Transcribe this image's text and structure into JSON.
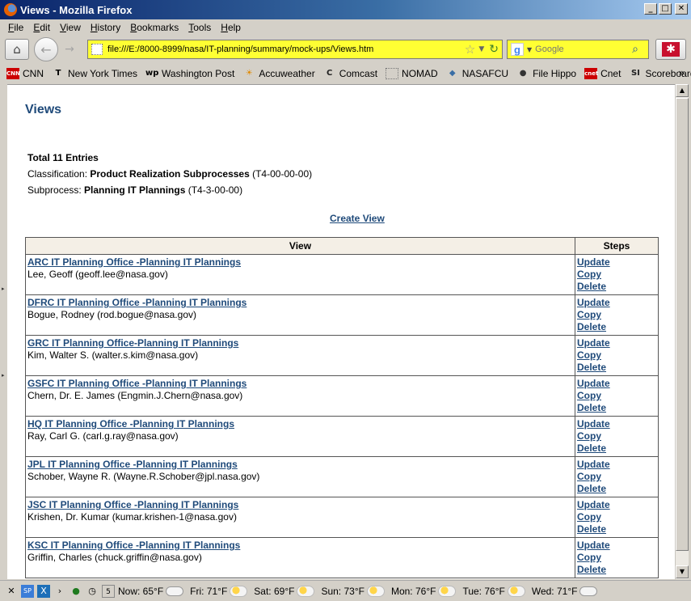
{
  "window": {
    "title": "Views - Mozilla Firefox",
    "buttons": {
      "minimize": "_",
      "maximize": "□",
      "close": "✕"
    }
  },
  "menu": [
    "File",
    "Edit",
    "View",
    "History",
    "Bookmarks",
    "Tools",
    "Help"
  ],
  "navbar": {
    "url": "file:///E:/8000-8999/nasa/IT-planning/summary/mock-ups/Views.htm",
    "search_placeholder": "Google"
  },
  "bookmarks": [
    {
      "label": "CNN",
      "icon": "cnn-icon",
      "glyph": "CNN",
      "color": "#cc0000"
    },
    {
      "label": "New York Times",
      "icon": "nyt-icon",
      "glyph": "T",
      "color": "#000000"
    },
    {
      "label": "Washington Post",
      "icon": "wp-icon",
      "glyph": "wp",
      "color": "#000000"
    },
    {
      "label": "Accuweather",
      "icon": "accuweather-icon",
      "glyph": "☀",
      "color": "#e08a00"
    },
    {
      "label": "Comcast",
      "icon": "comcast-icon",
      "glyph": "C",
      "color": "#222222"
    },
    {
      "label": "NOMAD",
      "icon": "page-icon",
      "glyph": "",
      "color": "#777777"
    },
    {
      "label": "NASAFCU",
      "icon": "nasafcu-icon",
      "glyph": "◆",
      "color": "#3a6ea5"
    },
    {
      "label": "File Hippo",
      "icon": "filehippo-icon",
      "glyph": "●",
      "color": "#333333"
    },
    {
      "label": "Cnet",
      "icon": "cnet-icon",
      "glyph": "cnet",
      "color": "#cc0000"
    },
    {
      "label": "Scoreboards",
      "icon": "si-icon",
      "glyph": "SI",
      "color": "#222222"
    }
  ],
  "page": {
    "title": "Views",
    "total": "Total 11 Entries",
    "classification_label": "Classification:",
    "classification_name": "Product Realization Subprocesses",
    "classification_code": "(T4-00-00-00)",
    "subprocess_label": "Subprocess:",
    "subprocess_name": "Planning IT Plannings",
    "subprocess_code": "(T4-3-00-00)",
    "create_link": "Create View",
    "table": {
      "headers": [
        "View",
        "Steps"
      ],
      "step_links": [
        "Update",
        "Copy",
        "Delete"
      ],
      "rows": [
        {
          "view": "ARC IT Planning Office -Planning IT Plannings",
          "owner": "Lee, Geoff (geoff.lee@nasa.gov)"
        },
        {
          "view": "DFRC IT Planning Office -Planning IT Plannings",
          "owner": "Bogue, Rodney (rod.bogue@nasa.gov)"
        },
        {
          "view": "GRC IT Planning Office-Planning IT Plannings",
          "owner": "Kim, Walter S. (walter.s.kim@nasa.gov)"
        },
        {
          "view": "GSFC IT Planning Office -Planning IT Plannings",
          "owner": "Chern, Dr. E. James (Engmin.J.Chern@nasa.gov)"
        },
        {
          "view": "HQ IT Planning Office -Planning IT Plannings",
          "owner": "Ray, Carl G. (carl.g.ray@nasa.gov)"
        },
        {
          "view": "JPL IT Planning Office -Planning IT Plannings",
          "owner": "Schober, Wayne R. (Wayne.R.Schober@jpl.nasa.gov)"
        },
        {
          "view": "JSC IT Planning Office -Planning IT Plannings",
          "owner": "Krishen, Dr. Kumar (kumar.krishen-1@nasa.gov)"
        },
        {
          "view": "KSC IT Planning Office -Planning IT Plannings",
          "owner": "Griffin, Charles (chuck.griffin@nasa.gov)"
        }
      ]
    }
  },
  "statusbar": {
    "weather": [
      {
        "label": "Now: 65°F",
        "icon": "cloud-icon"
      },
      {
        "label": "Fri: 71°F",
        "icon": "storm-icon"
      },
      {
        "label": "Sat: 69°F",
        "icon": "partly-cloudy-icon"
      },
      {
        "label": "Sun: 73°F",
        "icon": "partly-cloudy-icon"
      },
      {
        "label": "Mon: 76°F",
        "icon": "sunny-icon"
      },
      {
        "label": "Tue: 76°F",
        "icon": "partly-cloudy-icon"
      },
      {
        "label": "Wed: 71°F",
        "icon": "cloud-icon"
      }
    ]
  }
}
